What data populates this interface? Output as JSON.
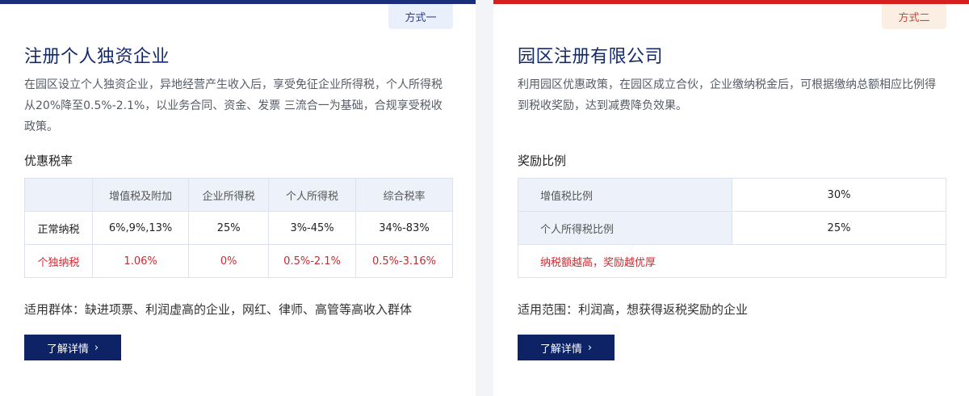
{
  "left": {
    "badge": "方式一",
    "title": "注册个人独资企业",
    "description": "在园区设立个人独资企业，异地经营产生收入后，享受免征企业所得税，个人所得税从20%降至0.5%-2.1%，以业务合同、资金、发票 三流合一为基础，合规享受税收政策。",
    "section_label": "优惠税率",
    "table": {
      "headers": [
        "",
        "增值税及附加",
        "企业所得税",
        "个人所得税",
        "综合税率"
      ],
      "rows": [
        [
          "正常纳税",
          "6%,9%,13%",
          "25%",
          "3%-45%",
          "34%-83%"
        ],
        [
          "个独纳税",
          "1.06%",
          "0%",
          "0.5%-2.1%",
          "0.5%-3.16%"
        ]
      ]
    },
    "scope": "适用群体：缺进项票、利润虚高的企业，网红、律师、高管等高收入群体",
    "button_label": "了解详情"
  },
  "right": {
    "badge": "方式二",
    "title": "园区注册有限公司",
    "description": "利用园区优惠政策，在园区成立合伙，企业缴纳税金后，可根据缴纳总额相应比例得到税收奖励，达到减费降负效果。",
    "section_label": "奖励比例",
    "table": {
      "rows": [
        [
          "增值税比例",
          "30%"
        ],
        [
          "个人所得税比例",
          "25%"
        ]
      ],
      "note": "纳税额越高，奖励越优厚"
    },
    "scope": "适用范围：利润高，想获得返税奖励的企业",
    "button_label": "了解详情"
  },
  "icons": {
    "button_arrow": "chevron-right-icon"
  },
  "colors": {
    "navy": "#0d2366",
    "accent_red": "#d0282e"
  }
}
